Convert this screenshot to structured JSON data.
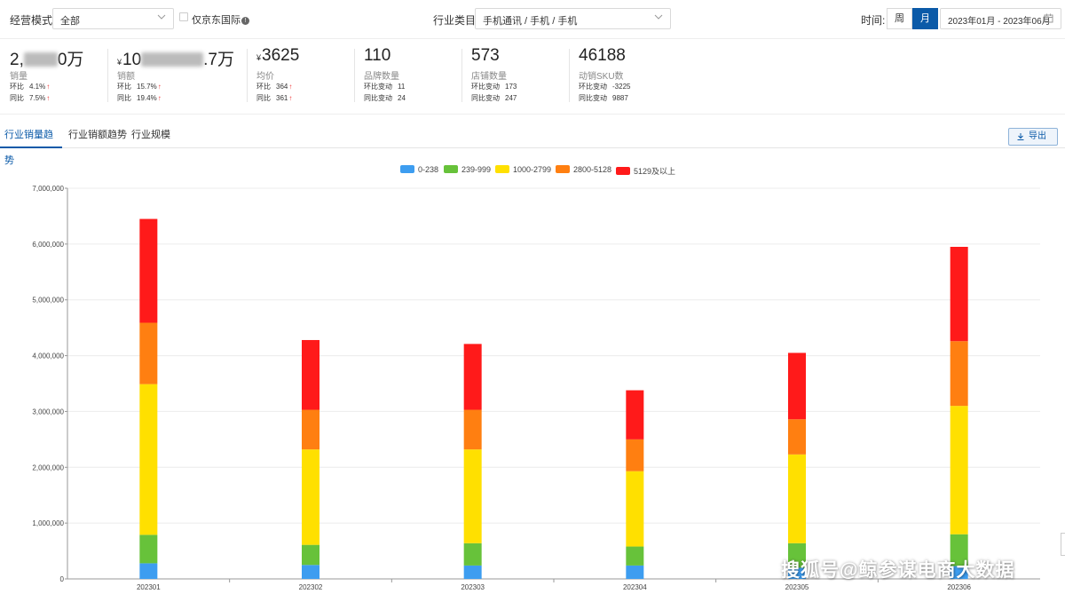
{
  "filters": {
    "mode_label": "经营模式:",
    "mode_value": "全部",
    "jd_intl_label": "仅京东国际",
    "category_label": "行业类目:",
    "category_value": "手机通讯 / 手机 / 手机",
    "time_label": "时间:",
    "week_label": "周",
    "month_label": "月",
    "date_range": "2023年01月 - 2023年06月"
  },
  "stats": [
    {
      "value_prefix": "2,",
      "value_suffix": "0万",
      "name": "销量",
      "l1_label": "环比",
      "l1_value": "4.1%",
      "l2_label": "同比",
      "l2_value": "7.5%"
    },
    {
      "value_prefix": "10",
      "value_suffix": ".7万",
      "yen": "¥",
      "name": "销额",
      "l1_label": "环比",
      "l1_value": "15.7%",
      "l2_label": "同比",
      "l2_value": "19.4%"
    },
    {
      "value_prefix": "3625",
      "yen": "¥",
      "name": "均价",
      "l1_label": "环比",
      "l1_value": "364",
      "l2_label": "同比",
      "l2_value": "361"
    },
    {
      "value_prefix": "110",
      "name": "品牌数量",
      "l1_label": "环比变动",
      "l1_value": "11",
      "l2_label": "同比变动",
      "l2_value": "24"
    },
    {
      "value_prefix": "573",
      "name": "店铺数量",
      "l1_label": "环比变动",
      "l1_value": "173",
      "l2_label": "同比变动",
      "l2_value": "247"
    },
    {
      "value_prefix": "46188",
      "name": "动销SKU数",
      "l1_label": "环比变动",
      "l1_value": "-3225",
      "l2_label": "同比变动",
      "l2_value": "9887"
    }
  ],
  "tabs": [
    "行业销量趋势",
    "行业销额趋势",
    "行业规模"
  ],
  "export_label": "导出",
  "watermark": "搜狐号@鲸参谋电商大数据",
  "colors": {
    "accent": "#0b5aa8",
    "up_arrow": "#e33333"
  },
  "chart_data": {
    "type": "bar",
    "stacked": true,
    "categories": [
      "202301",
      "202302",
      "202303",
      "202304",
      "202305",
      "202306"
    ],
    "series": [
      {
        "name": "0-238",
        "color": "#3d9df0",
        "values": [
          280000,
          250000,
          240000,
          240000,
          200000,
          230000
        ]
      },
      {
        "name": "239-999",
        "color": "#67c23a",
        "values": [
          510000,
          360000,
          400000,
          340000,
          440000,
          570000
        ]
      },
      {
        "name": "1000-2799",
        "color": "#ffe000",
        "values": [
          2700000,
          1710000,
          1680000,
          1350000,
          1590000,
          2300000
        ]
      },
      {
        "name": "2800-5128",
        "color": "#ff7f11",
        "values": [
          1100000,
          710000,
          710000,
          570000,
          630000,
          1160000
        ]
      },
      {
        "name": "5129及以上",
        "color": "#ff1a1a",
        "values": [
          1860000,
          1250000,
          1180000,
          880000,
          1190000,
          1690000
        ]
      }
    ],
    "ylim": [
      0,
      7000000
    ],
    "yticks": [
      "0",
      "1,000,000",
      "2,000,000",
      "3,000,000",
      "4,000,000",
      "5,000,000",
      "6,000,000",
      "7,000,000"
    ],
    "grid": true,
    "legend_position": "top-center"
  }
}
